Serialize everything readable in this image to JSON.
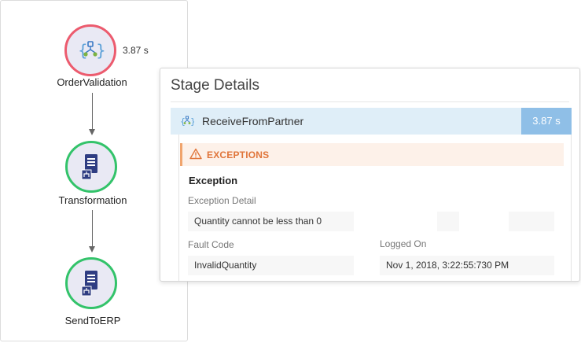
{
  "flow": {
    "nodes": [
      {
        "label": "OrderValidation",
        "duration": "3.87 s",
        "status": "error",
        "icon": "workflow-icon"
      },
      {
        "label": "Transformation",
        "status": "success",
        "icon": "document-transform-icon"
      },
      {
        "label": "SendToERP",
        "status": "success",
        "icon": "document-transform-icon"
      }
    ]
  },
  "details": {
    "title": "Stage Details",
    "stage": {
      "name": "ReceiveFromPartner",
      "time": "3.87 s",
      "icon": "workflow-icon"
    },
    "exceptions_label": "EXCEPTIONS",
    "exception_heading": "Exception",
    "exception_detail_label": "Exception Detail",
    "exception_detail_value": "Quantity cannot be less than 0",
    "fault_code_label": "Fault Code",
    "fault_code_value": "InvalidQuantity",
    "logged_on_label": "Logged On",
    "logged_on_value": "Nov 1, 2018, 3:22:55:730 PM"
  },
  "colors": {
    "error_ring": "#ec5b6e",
    "success_ring": "#33c36a",
    "stage_bar": "#dfeef8",
    "stage_time_bg": "#8fbfe7",
    "exception_accent": "#e0753a"
  }
}
